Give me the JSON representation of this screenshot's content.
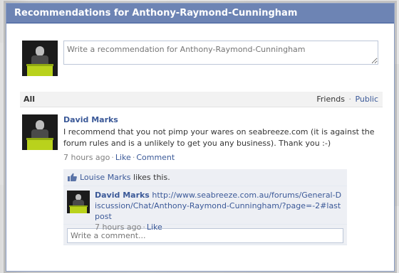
{
  "dialog": {
    "title": "Recommendations for Anthony-Raymond-Cunningham"
  },
  "compose": {
    "placeholder": "Write a recommendation for Anthony-Raymond-Cunningham"
  },
  "filter": {
    "all_label": "All",
    "friends_label": "Friends",
    "separator": "·",
    "public_label": "Public"
  },
  "post": {
    "author": "David Marks",
    "text": "I recommend that you not pimp your wares on seabreeze.com (it is against the forum rules and is a unlikely to get you any business). Thank you :-)",
    "time": "7 hours ago",
    "separator": "·",
    "like_label": "Like",
    "comment_label": "Comment",
    "likes": {
      "name": "Louise Marks",
      "suffix": " likes this."
    },
    "comments": [
      {
        "author": "David Marks",
        "link_text": "http://www.seabreeze.com.au/forums/General-Discussion/Chat/Anthony-Raymond-Cunningham/?page=-2#lastpost",
        "time": "7 hours ago",
        "like_label": "Like"
      }
    ],
    "write_placeholder": "Write a comment..."
  },
  "colors": {
    "header_bg": "#6d84b4",
    "link": "#3b5998",
    "ufi_bg": "#edeff4"
  },
  "icons": {
    "like": "thumbs-up-icon"
  }
}
